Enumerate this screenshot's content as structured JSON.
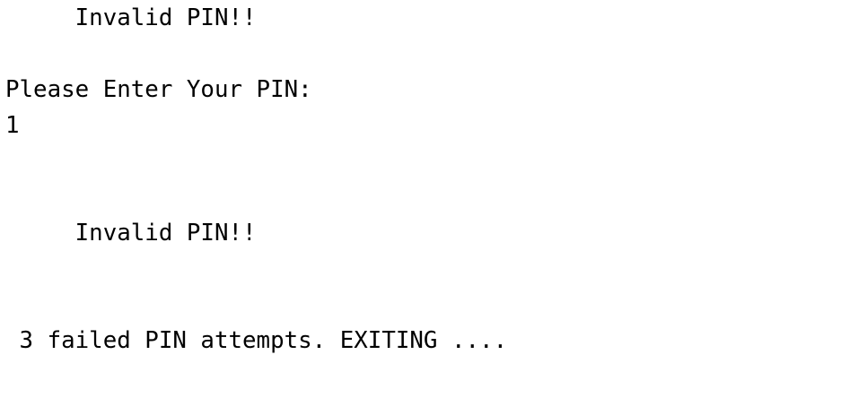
{
  "terminal": {
    "lines": [
      "     Invalid PIN!!",
      "",
      "Please Enter Your PIN:",
      "1",
      "",
      "",
      "     Invalid PIN!!",
      "",
      "",
      " 3 failed PIN attempts. EXITING ...."
    ]
  }
}
